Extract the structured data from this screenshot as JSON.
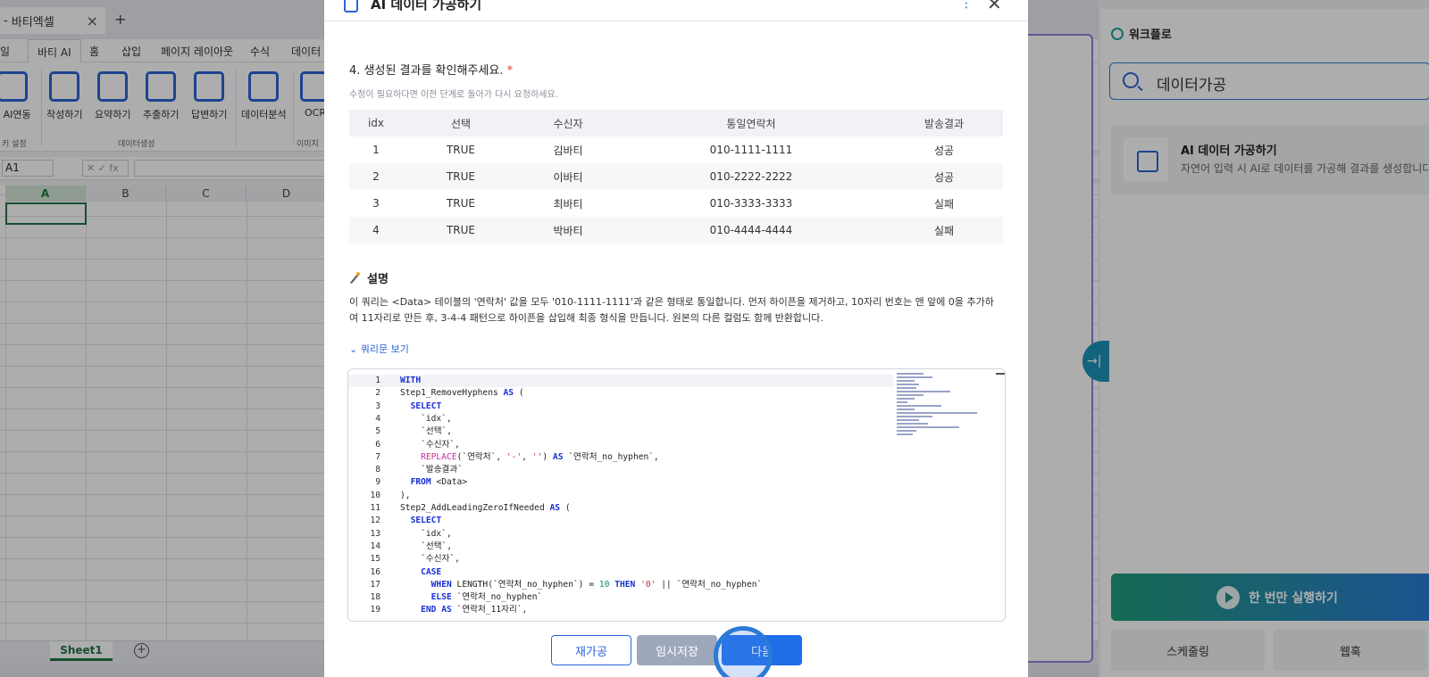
{
  "app": {
    "doc_tab": "바티엑셀",
    "doc_tab_prefix": "-",
    "new_tab": "+",
    "close_tab": "×"
  },
  "ribbon": {
    "tabs": [
      "일",
      "바티 AI",
      "홈",
      "삽입",
      "페이지 레이아웃",
      "수식",
      "데이터"
    ],
    "active_tab": "바티 AI",
    "buttons": [
      "ll AI연동",
      "작성하기",
      "요약하기",
      "추출하기",
      "답변하기",
      "데이터분석",
      "OCR"
    ],
    "groups": [
      "키 설정",
      "데이터생성",
      "이미지"
    ]
  },
  "formula_bar": {
    "cell_ref": "A1",
    "fx": "✕ ✓ fx"
  },
  "sheet": {
    "columns": [
      "A",
      "B",
      "C",
      "D"
    ],
    "tab": "Sheet1",
    "add": "+"
  },
  "workflow_panel": {
    "title": "워크플로",
    "search_value": "데이터가공",
    "card_title": "AI 데이터 가공하기",
    "card_desc": "자연어 입력 시 AI로 데이터를 가공해 결과를 생성합니다",
    "run_button": "한 번만 실행하기",
    "schedule_button": "스케줄링",
    "webhook_button": "웹훅",
    "handle": "→|"
  },
  "modal": {
    "title": "AI 데이터 가공하기",
    "more": "⋮",
    "close": "✕",
    "step_title": "4. 생성된 결과를 확인해주세요.",
    "required_mark": "*",
    "step_subtitle": "수정이 필요하다면 이전 단계로 돌아가 다시 요청하세요.",
    "table": {
      "headers": [
        "idx",
        "선택",
        "수신자",
        "통일연락처",
        "발송결과"
      ],
      "rows": [
        [
          "1",
          "TRUE",
          "김바티",
          "010-1111-1111",
          "성공"
        ],
        [
          "2",
          "TRUE",
          "이바티",
          "010-2222-2222",
          "성공"
        ],
        [
          "3",
          "TRUE",
          "최바티",
          "010-3333-3333",
          "실패"
        ],
        [
          "4",
          "TRUE",
          "박바티",
          "010-4444-4444",
          "실패"
        ]
      ]
    },
    "explanation_title": "설명",
    "explanation_text": "이 쿼리는 <Data> 테이블의 '연락처' 값을 모두 '010-1111-1111'과 같은 형태로 통일합니다. 먼저 하이픈을 제거하고, 10자리 번호는 맨 앞에 0을 추가하여 11자리로 만든 후, 3-4-4 패턴으로 하이픈을 삽입해 최종 형식을 만듭니다. 원본의 다른 컬럼도 함께 반환합니다.",
    "toggle_query": "쿼리문 보기",
    "buttons": {
      "reprocess": "재가공",
      "temp_save": "임시저장",
      "next": "다음"
    }
  },
  "code_lines": [
    "1",
    "2",
    "3",
    "4",
    "5",
    "6",
    "7",
    "8",
    "9",
    "10",
    "11",
    "12",
    "13",
    "14",
    "15",
    "16",
    "17",
    "18",
    "19"
  ]
}
